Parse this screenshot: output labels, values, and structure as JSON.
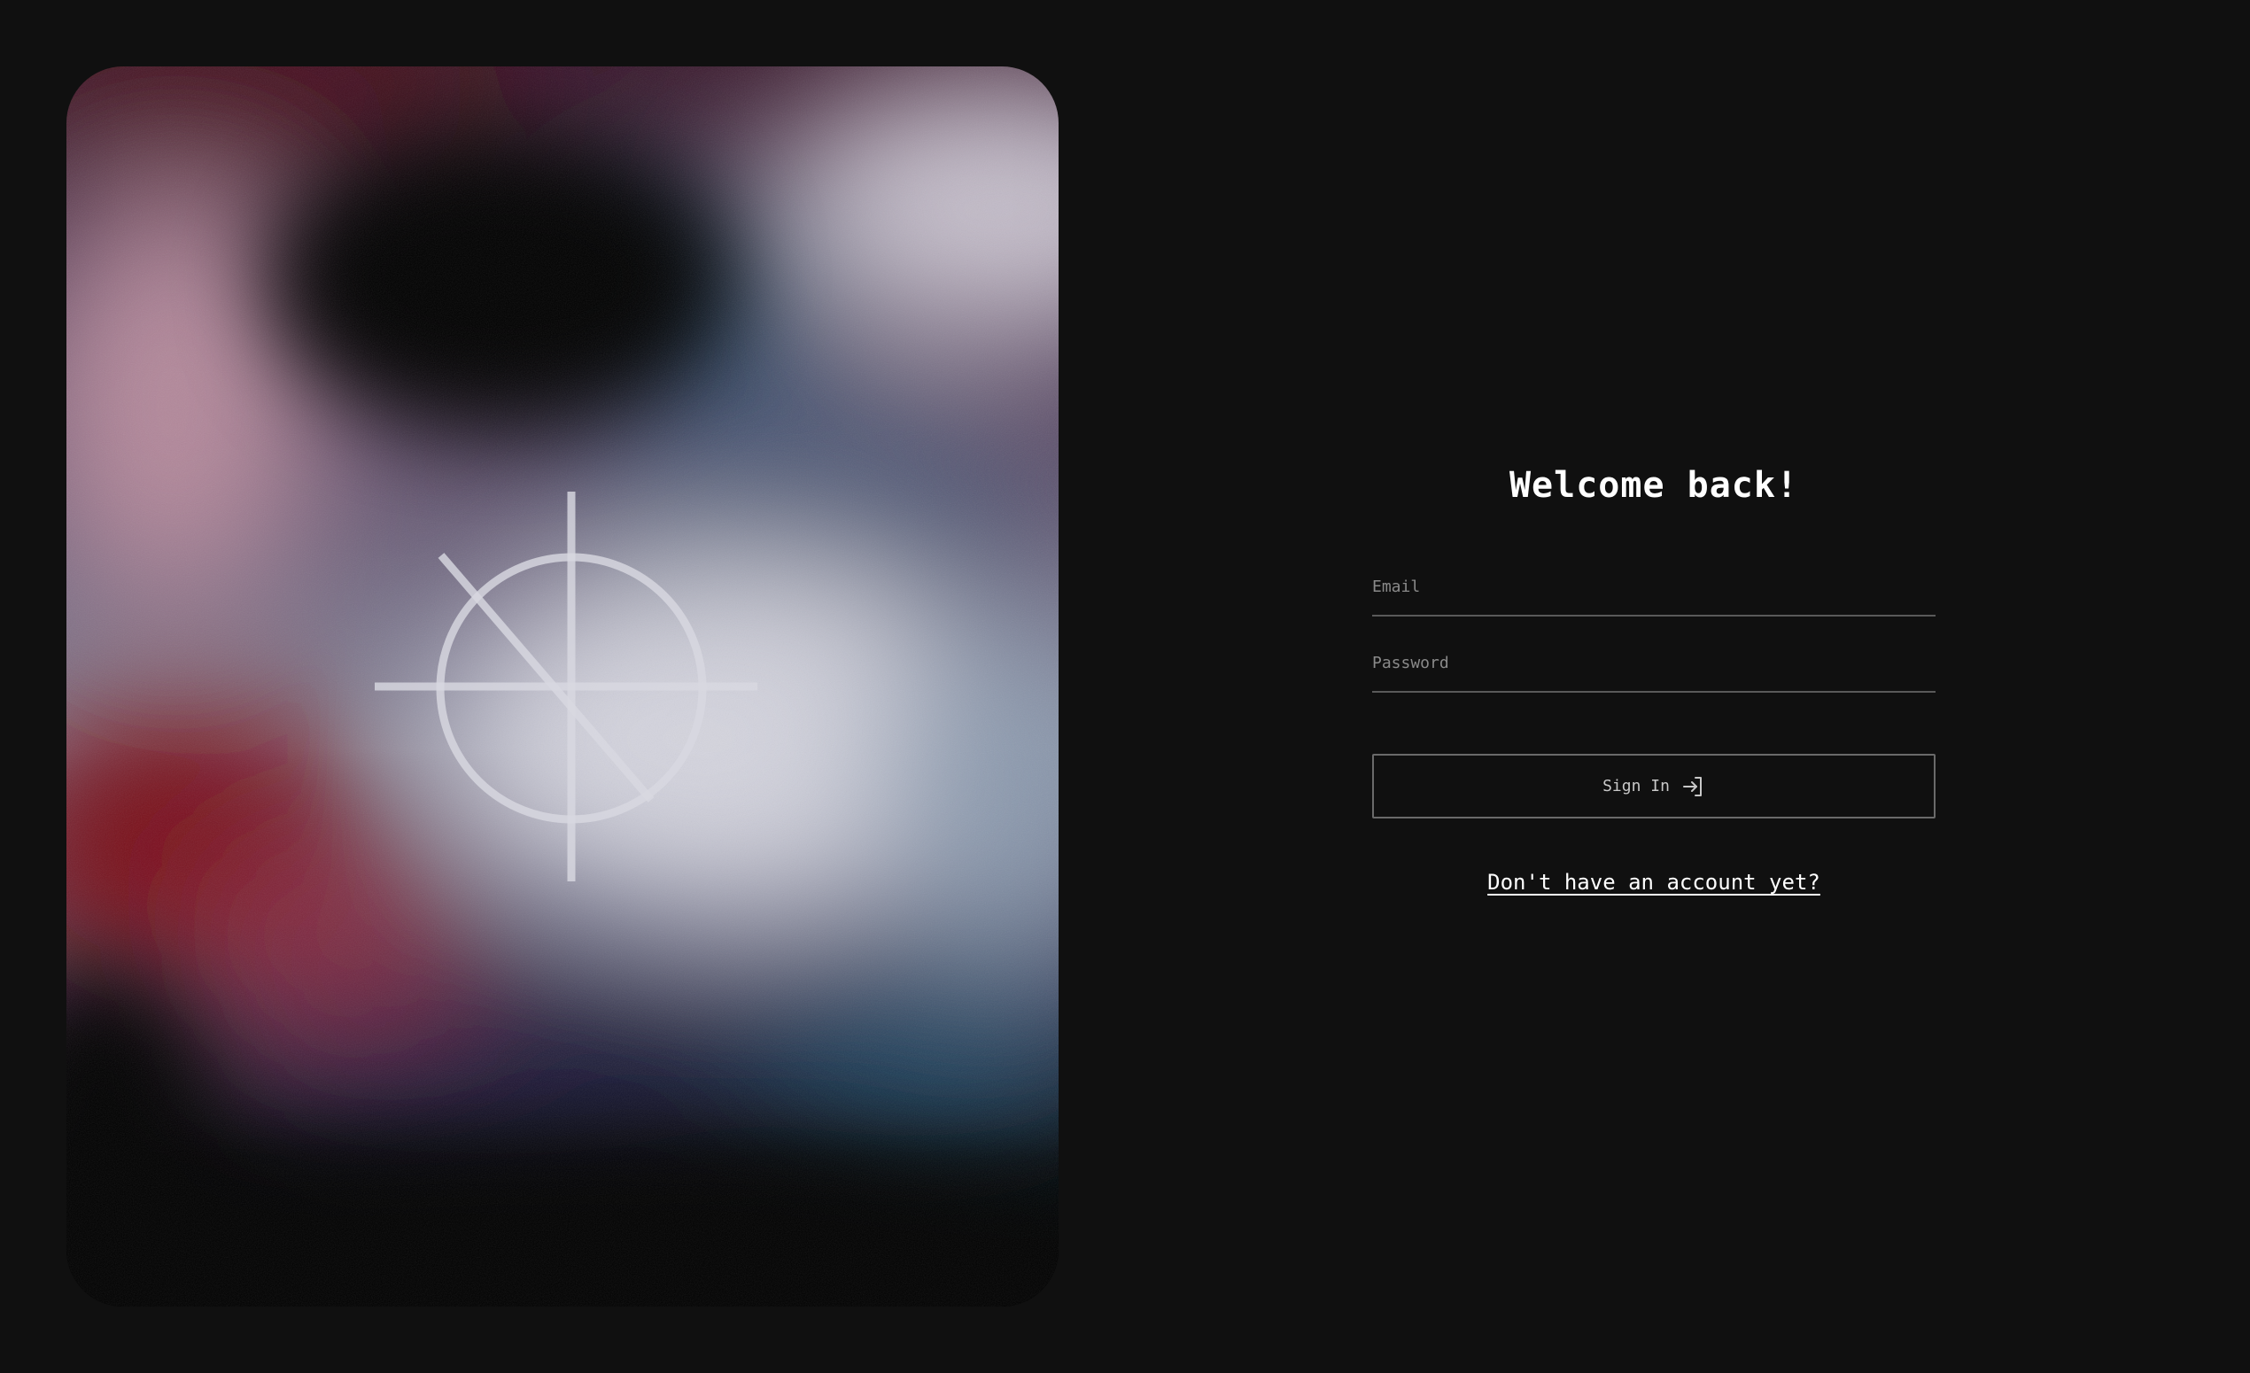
{
  "login": {
    "title": "Welcome back!",
    "email_placeholder": "Email",
    "email_value": "",
    "password_placeholder": "Password",
    "password_value": "",
    "signin_label": "Sign In",
    "signin_icon": "sign-in-icon",
    "signup_link": "Don't have an account yet?"
  },
  "hero": {
    "logo_icon": "crosshair-logo-icon"
  },
  "colors": {
    "background": "#101010",
    "text": "#ffffff",
    "field_border": "#5a5a5a",
    "button_border": "#6a6a6a",
    "placeholder": "#8a8a8a"
  }
}
